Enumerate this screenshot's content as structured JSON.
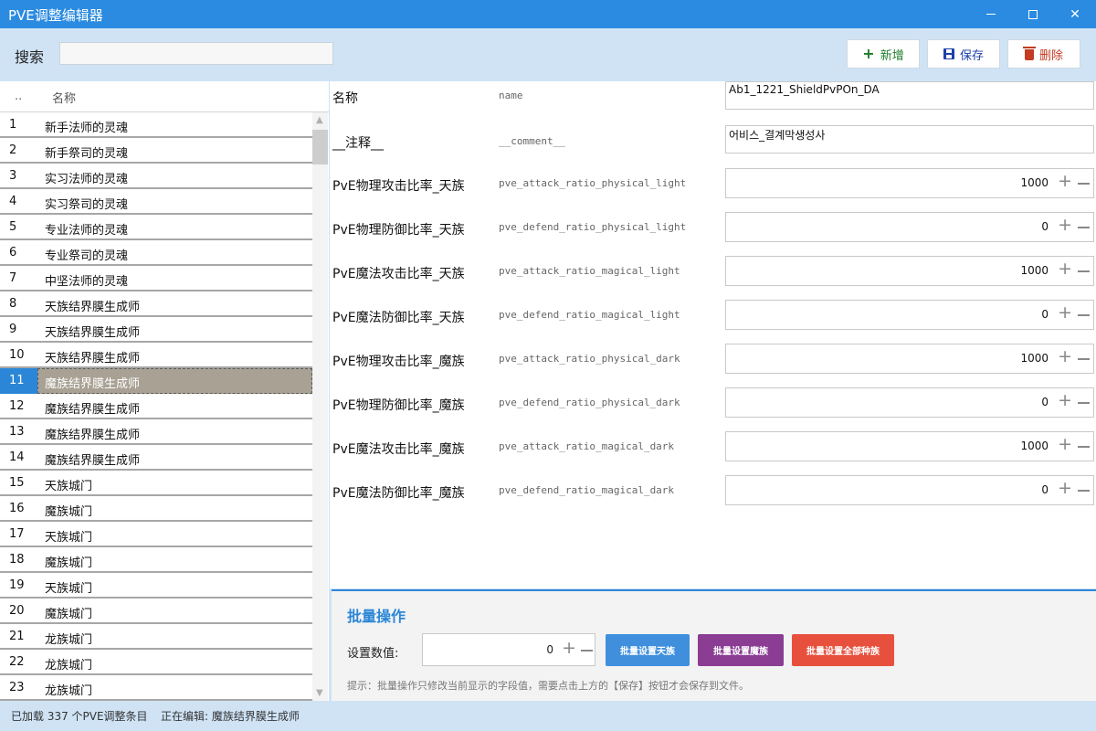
{
  "window": {
    "title": "PVE调整编辑器"
  },
  "toolbar": {
    "search_label": "搜索",
    "search_value": "",
    "add_label": "新增",
    "save_label": "保存",
    "delete_label": "删除"
  },
  "list": {
    "header_index": "..",
    "header_name": "名称",
    "selected_index": 10,
    "items": [
      {
        "index": "1",
        "name": "新手法师的灵魂"
      },
      {
        "index": "2",
        "name": "新手祭司的灵魂"
      },
      {
        "index": "3",
        "name": "实习法师的灵魂"
      },
      {
        "index": "4",
        "name": "实习祭司的灵魂"
      },
      {
        "index": "5",
        "name": "专业法师的灵魂"
      },
      {
        "index": "6",
        "name": "专业祭司的灵魂"
      },
      {
        "index": "7",
        "name": "中坚法师的灵魂"
      },
      {
        "index": "8",
        "name": "天族结界膜生成师"
      },
      {
        "index": "9",
        "name": "天族结界膜生成师"
      },
      {
        "index": "10",
        "name": "天族结界膜生成师"
      },
      {
        "index": "11",
        "name": "魔族结界膜生成师"
      },
      {
        "index": "12",
        "name": "魔族结界膜生成师"
      },
      {
        "index": "13",
        "name": "魔族结界膜生成师"
      },
      {
        "index": "14",
        "name": "魔族结界膜生成师"
      },
      {
        "index": "15",
        "name": "天族城门"
      },
      {
        "index": "16",
        "name": "魔族城门"
      },
      {
        "index": "17",
        "name": "天族城门"
      },
      {
        "index": "18",
        "name": "魔族城门"
      },
      {
        "index": "19",
        "name": "天族城门"
      },
      {
        "index": "20",
        "name": "魔族城门"
      },
      {
        "index": "21",
        "name": "龙族城门"
      },
      {
        "index": "22",
        "name": "龙族城门"
      },
      {
        "index": "23",
        "name": "龙族城门"
      }
    ]
  },
  "fields": {
    "name": {
      "label": "名称",
      "key": "name",
      "value": "Ab1_1221_ShieldPvPOn_DA"
    },
    "comment": {
      "label": "__注释__",
      "key": "__comment__",
      "value": "어비스_결계막생성사"
    },
    "numeric": [
      {
        "label": "PvE物理攻击比率_天族",
        "key": "pve_attack_ratio_physical_light",
        "value": "1000"
      },
      {
        "label": "PvE物理防御比率_天族",
        "key": "pve_defend_ratio_physical_light",
        "value": "0"
      },
      {
        "label": "PvE魔法攻击比率_天族",
        "key": "pve_attack_ratio_magical_light",
        "value": "1000"
      },
      {
        "label": "PvE魔法防御比率_天族",
        "key": "pve_defend_ratio_magical_light",
        "value": "0"
      },
      {
        "label": "PvE物理攻击比率_魔族",
        "key": "pve_attack_ratio_physical_dark",
        "value": "1000"
      },
      {
        "label": "PvE物理防御比率_魔族",
        "key": "pve_defend_ratio_physical_dark",
        "value": "0"
      },
      {
        "label": "PvE魔法攻击比率_魔族",
        "key": "pve_attack_ratio_magical_dark",
        "value": "1000"
      },
      {
        "label": "PvE魔法防御比率_魔族",
        "key": "pve_defend_ratio_magical_dark",
        "value": "0"
      }
    ]
  },
  "batch": {
    "title": "批量操作",
    "value_label": "设置数值:",
    "value": "0",
    "btn_light": "批量设置天族",
    "btn_dark": "批量设置魔族",
    "btn_all": "批量设置全部种族",
    "hint": "提示：批量操作只修改当前显示的字段值，需要点击上方的【保存】按钮才会保存到文件。"
  },
  "status": {
    "loaded": "已加载 337 个PVE调整条目",
    "editing": "正在编辑: 魔族结界膜生成师"
  },
  "colors": {
    "titlebar": "#2b8be0",
    "accent": "#2b86d8",
    "selection_row": "#a8a194",
    "batch_light": "#3f8fdd",
    "batch_dark": "#8a3d93",
    "batch_all": "#e8503e"
  }
}
